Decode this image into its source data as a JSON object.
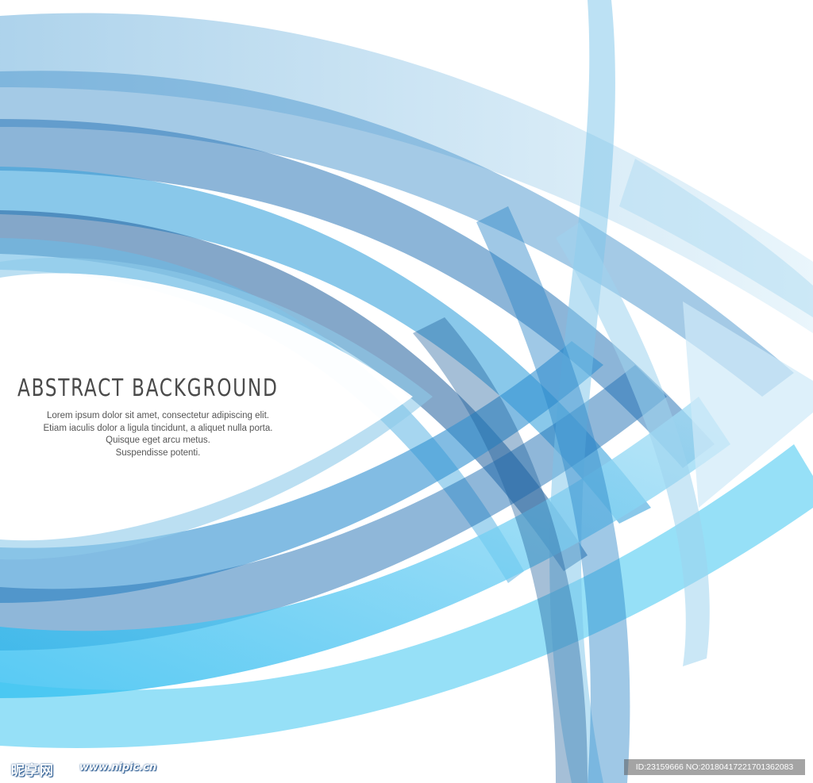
{
  "poster": {
    "headline": "ABSTRACT BACKGROUND",
    "body_lines": [
      "Lorem ipsum dolor sit amet, consectetur adipiscing elit.",
      "Etiam iaculis dolor a ligula tincidunt, a aliquet nulla porta.",
      "Quisque eget arcu metus.",
      "Suspendisse potenti."
    ]
  },
  "watermark": {
    "logo": "昵享网",
    "url": "www.nipic.cn",
    "id_line": "ID:23159666 NO:20180417221701362083"
  },
  "colors": {
    "deep_blue": "#1f5f9c",
    "mid_blue": "#2e8fd0",
    "cyan": "#3fc7f0",
    "pale_blue": "#bfe3f5",
    "text_gray": "#4a4a4a"
  }
}
